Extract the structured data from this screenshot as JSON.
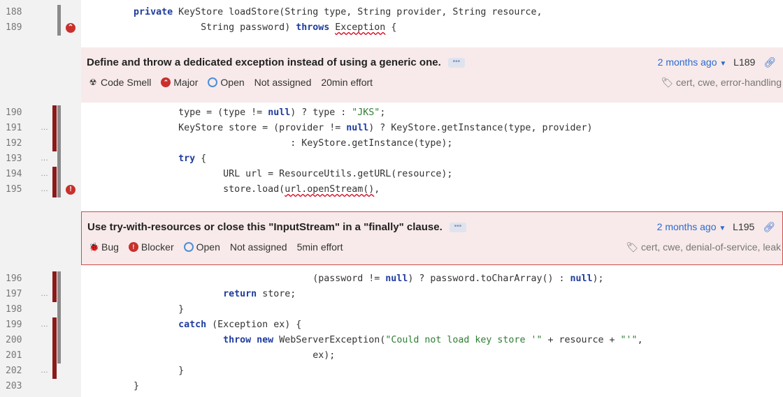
{
  "lines": [
    {
      "n": "188",
      "dup": "",
      "scm": false,
      "cov": true,
      "sev": "",
      "tokens": [
        {
          "t": "        "
        },
        {
          "t": "private",
          "c": "kw"
        },
        {
          "t": " KeyStore loadStore(String type, String provider, String resource,"
        }
      ]
    },
    {
      "n": "189",
      "dup": "",
      "scm": false,
      "cov": true,
      "sev": "major",
      "tokens": [
        {
          "t": "                    String password) "
        },
        {
          "t": "throws",
          "c": "kw"
        },
        {
          "t": " "
        },
        {
          "t": "Exception",
          "c": "sq"
        },
        {
          "t": " {"
        }
      ]
    },
    {
      "n": "190",
      "dup": "",
      "scm": true,
      "cov": true,
      "sev": "",
      "tokens": [
        {
          "t": "                "
        },
        {
          "t": "type = (type != "
        },
        {
          "t": "null",
          "c": "kw"
        },
        {
          "t": ") ? type : "
        },
        {
          "t": "\"JKS\"",
          "c": "str"
        },
        {
          "t": ";"
        }
      ]
    },
    {
      "n": "191",
      "dup": "…",
      "scm": true,
      "cov": true,
      "sev": "",
      "tokens": [
        {
          "t": "                KeyStore store = (provider != "
        },
        {
          "t": "null",
          "c": "kw"
        },
        {
          "t": ") ? KeyStore.getInstance(type, provider)"
        }
      ]
    },
    {
      "n": "192",
      "dup": "",
      "scm": true,
      "cov": true,
      "sev": "",
      "tokens": [
        {
          "t": "                                    : KeyStore.getInstance(type);"
        }
      ]
    },
    {
      "n": "193",
      "dup": "…",
      "scm": false,
      "cov": true,
      "sev": "",
      "tokens": [
        {
          "t": "                "
        },
        {
          "t": "try",
          "c": "kw"
        },
        {
          "t": " {"
        }
      ]
    },
    {
      "n": "194",
      "dup": "…",
      "scm": true,
      "cov": true,
      "sev": "",
      "tokens": [
        {
          "t": "                        URL url = ResourceUtils.getURL(resource);"
        }
      ]
    },
    {
      "n": "195",
      "dup": "…",
      "scm": true,
      "cov": true,
      "sev": "blocker",
      "tokens": [
        {
          "t": "                        store.load("
        },
        {
          "t": "url.openStream()",
          "c": "sq"
        },
        {
          "t": ","
        }
      ]
    },
    {
      "n": "196",
      "dup": "",
      "scm": true,
      "cov": true,
      "sev": "",
      "tokens": [
        {
          "t": "                                        (password != "
        },
        {
          "t": "null",
          "c": "kw"
        },
        {
          "t": ") ? password.toCharArray() : "
        },
        {
          "t": "null",
          "c": "kw"
        },
        {
          "t": ");"
        }
      ]
    },
    {
      "n": "197",
      "dup": "…",
      "scm": true,
      "cov": true,
      "sev": "",
      "tokens": [
        {
          "t": "                        "
        },
        {
          "t": "return",
          "c": "kw"
        },
        {
          "t": " store;"
        }
      ]
    },
    {
      "n": "198",
      "dup": "",
      "scm": false,
      "cov": true,
      "sev": "",
      "tokens": [
        {
          "t": "                }"
        }
      ]
    },
    {
      "n": "199",
      "dup": "…",
      "scm": true,
      "cov": true,
      "sev": "",
      "tokens": [
        {
          "t": "                "
        },
        {
          "t": "catch",
          "c": "kw"
        },
        {
          "t": " (Exception ex) {"
        }
      ]
    },
    {
      "n": "200",
      "dup": "",
      "scm": true,
      "cov": true,
      "sev": "",
      "tokens": [
        {
          "t": "                        "
        },
        {
          "t": "throw new",
          "c": "kw"
        },
        {
          "t": " WebServerException("
        },
        {
          "t": "\"Could not load key store '\"",
          "c": "str"
        },
        {
          "t": " + resource + "
        },
        {
          "t": "\"'\"",
          "c": "str"
        },
        {
          "t": ","
        }
      ]
    },
    {
      "n": "201",
      "dup": "",
      "scm": true,
      "cov": true,
      "sev": "",
      "tokens": [
        {
          "t": "                                        ex);"
        }
      ]
    },
    {
      "n": "202",
      "dup": "…",
      "scm": true,
      "cov": false,
      "sev": "",
      "tokens": [
        {
          "t": "                }"
        }
      ]
    },
    {
      "n": "203",
      "dup": "",
      "scm": false,
      "cov": false,
      "sev": "",
      "tokens": [
        {
          "t": "        }"
        }
      ]
    }
  ],
  "issues": [
    {
      "title": "Define and throw a dedicated exception instead of using a generic one.",
      "more": "•••",
      "type_icon": "code-smell-icon",
      "type_glyph": "☢",
      "type": "Code Smell",
      "severity_icon": "major-severity-icon",
      "severity_glyph": "⌃",
      "severity": "Major",
      "status": "Open",
      "assignee": "Not assigned",
      "effort": "20min effort",
      "age": "2 months ago",
      "line_ref": "L189",
      "tags": "cert, cwe, error-handling"
    },
    {
      "title": "Use try-with-resources or close this \"InputStream\" in a \"finally\" clause.",
      "more": "•••",
      "type_icon": "bug-icon",
      "type_glyph": "🐞",
      "type": "Bug",
      "severity_icon": "blocker-severity-icon",
      "severity_glyph": "!",
      "severity": "Blocker",
      "status": "Open",
      "assignee": "Not assigned",
      "effort": "5min effort",
      "age": "2 months ago",
      "line_ref": "L195",
      "tags": "cert, cwe, denial-of-service, leak"
    }
  ],
  "colors": {
    "scm": "#8b1a1a",
    "coverage": "#8a8a8a",
    "issue_bg": "#f8eaea",
    "issue_border": "#d04b4b",
    "keyword": "#1f3c9e",
    "string": "#2e7d32"
  }
}
